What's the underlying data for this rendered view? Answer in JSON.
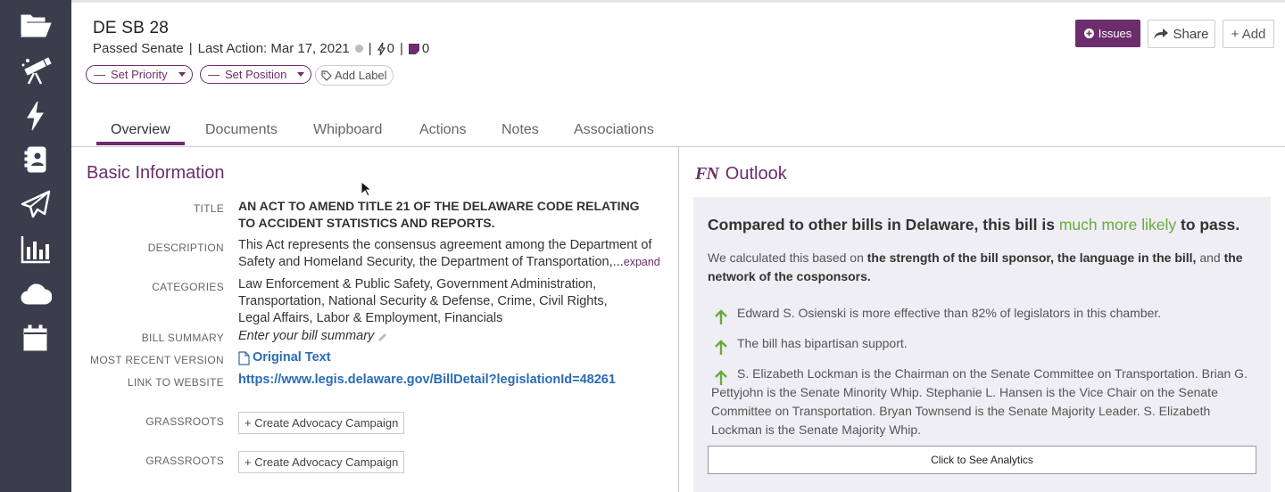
{
  "sidebar": {
    "items": [
      {
        "icon": "folder-open-icon"
      },
      {
        "icon": "telescope-icon"
      },
      {
        "icon": "lightning-icon"
      },
      {
        "icon": "contact-book-icon"
      },
      {
        "icon": "paper-plane-icon"
      },
      {
        "icon": "bar-chart-icon"
      },
      {
        "icon": "cloud-icon"
      },
      {
        "icon": "calendar-icon"
      }
    ]
  },
  "header": {
    "bill_id": "DE SB 28",
    "status": "Passed Senate",
    "sep1": "|",
    "last_action": "Last Action: Mar 17, 2021",
    "sep2": "|",
    "bolt_count": "0",
    "sep3": "|",
    "notes_count": "0",
    "set_priority": "Set Priority",
    "set_position": "Set Position",
    "add_label": "Add Label",
    "issues": "Issues",
    "share": "Share",
    "add": "+ Add"
  },
  "tabs": [
    "Overview",
    "Documents",
    "Whipboard",
    "Actions",
    "Notes",
    "Associations"
  ],
  "basic": {
    "title": "Basic Information",
    "title_label": "TITLE",
    "title_value": "AN ACT TO AMEND TITLE 21 OF THE DELAWARE CODE RELATING TO ACCIDENT STATISTICS AND REPORTS.",
    "description_label": "DESCRIPTION",
    "description_value": "This Act represents the consensus agreement among the Department of Safety and Homeland Security, the Department of Transportation,...",
    "expand": "expand",
    "categories_label": "CATEGORIES",
    "categories_value": "Law Enforcement & Public Safety, Government Administration, Transportation, National Security & Defense, Crime, Civil Rights, Legal Affairs, Labor & Employment, Financials",
    "summary_label": "BILL SUMMARY",
    "summary_placeholder": "Enter your bill summary",
    "version_label": "MOST RECENT VERSION",
    "version_value": "Original Text",
    "website_label": "LINK TO WEBSITE",
    "website_value": "https://www.legis.delaware.gov/BillDetail?legislationId=48261",
    "grassroots_label_1": "GRASSROOTS",
    "campaign_btn_1": "+ Create Advocacy Campaign",
    "grassroots_label_2": "GRASSROOTS",
    "campaign_btn_2": "+ Create Advocacy Campaign"
  },
  "outlook": {
    "logo": "FN",
    "title": "Outlook",
    "head_prefix": "Compared to other bills in Delaware, this bill is ",
    "head_highlight": "much more likely",
    "head_suffix": " to pass.",
    "sub_prefix": "We calculated this based on ",
    "sub_bold1": "the strength of the bill sponsor, the language in the bill,",
    "sub_mid": " and ",
    "sub_bold2": "the network of the cosponsors.",
    "reasons": [
      "Edward S. Osienski is more effective than 82% of legislators in this chamber.",
      "The bill has bipartisan support.",
      "S. Elizabeth Lockman is the Chairman on the Senate Committee on Transportation. Brian G. Pettyjohn is the Senate Minority Whip. Stephanie L. Hansen is the Vice Chair on the Senate Committee on Transportation. Bryan Townsend is the Senate Majority Leader. S. Elizabeth Lockman is the Senate Majority Whip."
    ],
    "analytics_button": "Click to See Analytics"
  },
  "colors": {
    "brand_purple": "#6b2d6b",
    "sidebar_bg": "#3b3d4c",
    "link_blue": "#2a6bb5",
    "likely_green": "#6aaa3a"
  }
}
